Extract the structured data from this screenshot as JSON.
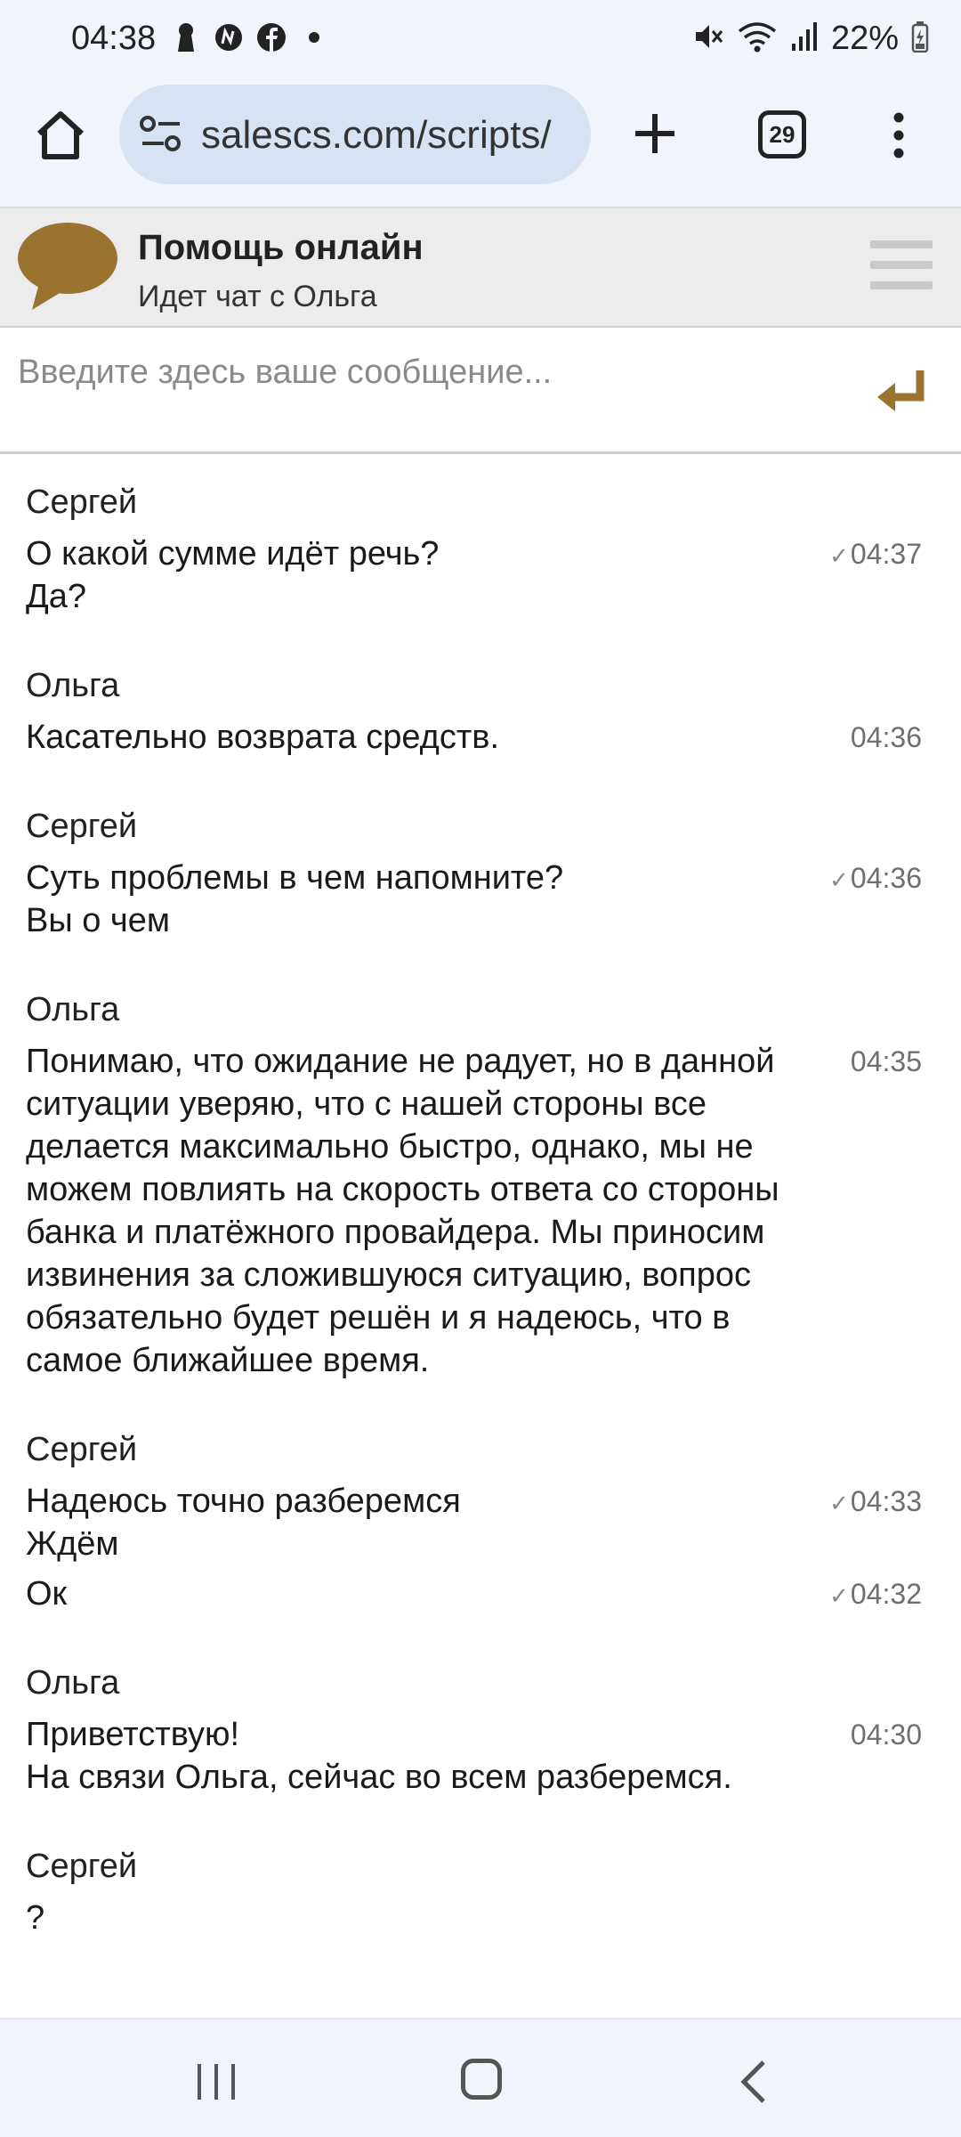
{
  "status_bar": {
    "time": "04:38",
    "battery": "22%",
    "icons_left": [
      "keyhole-icon",
      "notification-app-icon",
      "facebook-icon",
      "dot-icon"
    ],
    "icons_right": [
      "mute-icon",
      "wifi-icon",
      "signal-icon",
      "battery-icon"
    ]
  },
  "browser": {
    "url": "salescs.com/scripts/",
    "tab_count": "29"
  },
  "chat_header": {
    "title": "Помощь онлайн",
    "subtitle": "Идет чат с Ольга"
  },
  "input": {
    "placeholder": "Введите здесь ваше сообщение..."
  },
  "colors": {
    "accent": "#9a7330",
    "browser_bg": "#f1f4fb",
    "url_pill": "#d6e3f4"
  },
  "messages": [
    {
      "sender": "Сергей",
      "items": [
        {
          "text": "О какой сумме идёт речь?\nДа?",
          "time": "04:37",
          "read": true
        }
      ]
    },
    {
      "sender": "Ольга",
      "items": [
        {
          "text": "Касательно возврата средств.",
          "time": "04:36",
          "read": false
        }
      ]
    },
    {
      "sender": "Сергей",
      "items": [
        {
          "text": "Суть проблемы в чем напомните?\nВы о чем",
          "time": "04:36",
          "read": true
        }
      ]
    },
    {
      "sender": "Ольга",
      "items": [
        {
          "text": "Понимаю, что ожидание не радует, но в данной ситуации уверяю, что с нашей стороны все делается максимально быстро, однако, мы не можем повлиять на скорость ответа со стороны банка и платёжного провайдера. Мы приносим извинения за сложившуюся ситуацию, вопрос обязательно будет решён и я надеюсь, что в самое ближайшее время.",
          "time": "04:35",
          "read": false
        }
      ]
    },
    {
      "sender": "Сергей",
      "items": [
        {
          "text": "Надеюсь точно разберемся\nЖдём",
          "time": "04:33",
          "read": true
        },
        {
          "text": "Ок",
          "time": "04:32",
          "read": true
        }
      ]
    },
    {
      "sender": "Ольга",
      "items": [
        {
          "text": "Приветствую!\nНа связи Ольга, сейчас во всем разберемся.",
          "time": "04:30",
          "read": false
        }
      ]
    },
    {
      "sender": "Сергей",
      "items": [
        {
          "text": "?",
          "time": "",
          "read": false
        }
      ]
    }
  ]
}
